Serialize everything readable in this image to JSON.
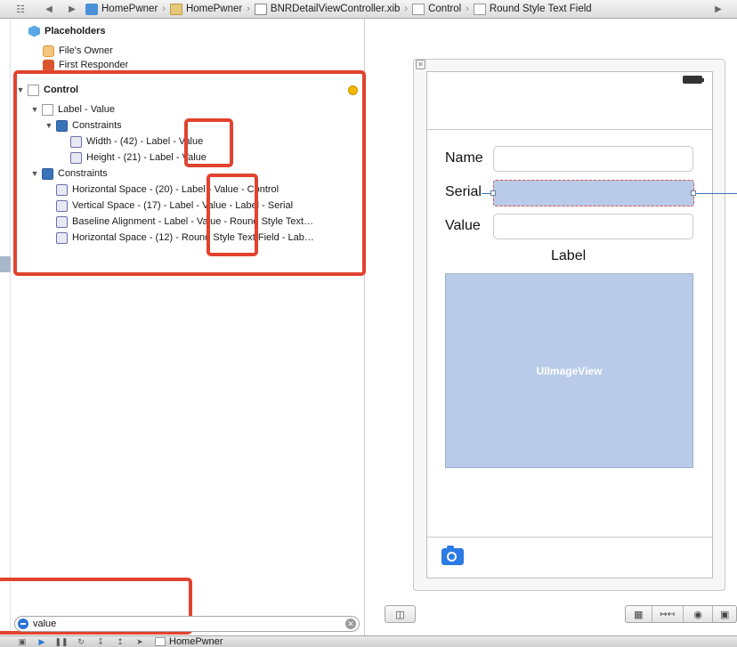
{
  "jumpbar": {
    "crumbs": [
      {
        "label": "HomePwner",
        "icon": "project-icon"
      },
      {
        "label": "HomePwner",
        "icon": "folder-icon"
      },
      {
        "label": "BNRDetailViewController.xib",
        "icon": "xib-file-icon"
      },
      {
        "label": "Control",
        "icon": "view-icon"
      },
      {
        "label": "Round Style Text Field",
        "icon": "view-icon"
      }
    ]
  },
  "outline": {
    "placeholders": "Placeholders",
    "files_owner": "File's Owner",
    "first_responder": "First Responder",
    "control": "Control",
    "label_value": "Label - Value",
    "constraints_inner": "Constraints",
    "width": "Width - (42) - Label - Value",
    "height": "Height - (21) - Label - Value",
    "constraints_outer": "Constraints",
    "c1": "Horizontal Space - (20) - Label - Value - Control",
    "c2": "Vertical Space - (17) - Label - Value - Label - Serial",
    "c3": "Baseline Alignment - Label - Value - Round Style Text…",
    "c4": "Horizontal Space - (12) - Round Style Text Field - Lab…"
  },
  "filter": {
    "value": "value"
  },
  "canvas": {
    "name_label": "Name",
    "serial_label": "Serial",
    "value_label": "Value",
    "label_label": "Label",
    "imageview_label": "UIImageView"
  },
  "debugbar": {
    "target": "HomePwner"
  },
  "colors": {
    "accent": "#2c72d8",
    "callout": "#e0432f",
    "selection": "#b9cbe8"
  }
}
